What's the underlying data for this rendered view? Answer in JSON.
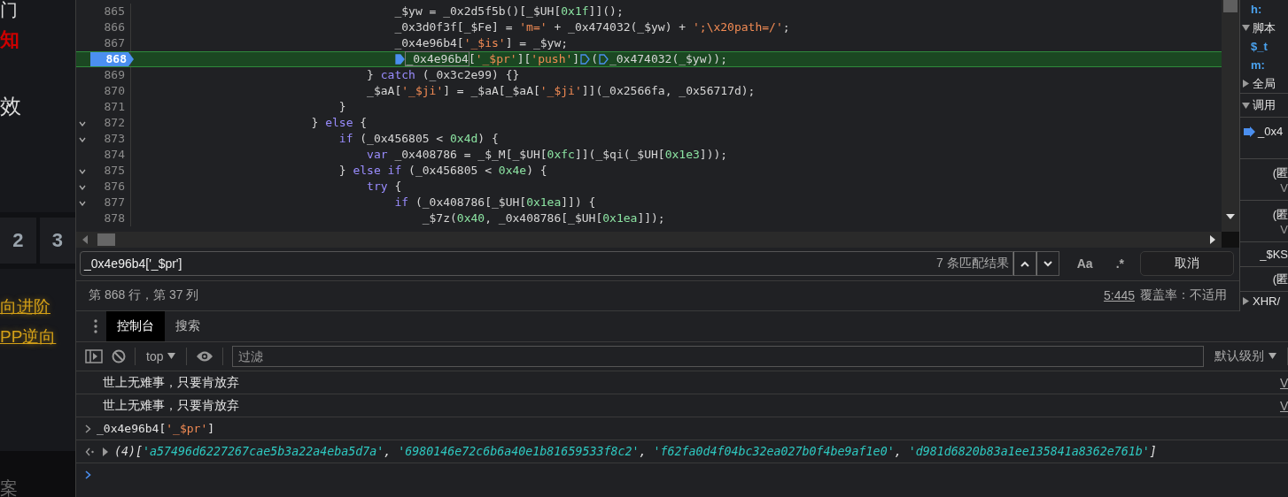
{
  "web_page": {
    "lines": [
      {
        "kind": "plain",
        "text": "门"
      },
      {
        "kind": "alert",
        "text": "知"
      },
      {
        "kind": "large",
        "text": "效"
      }
    ],
    "pager": [
      {
        "label": "2"
      },
      {
        "label": "3"
      }
    ],
    "links": [
      "向进阶",
      "PP逆向"
    ],
    "footer": "案"
  },
  "editor": {
    "lines": [
      {
        "number": "865",
        "fold": false,
        "current": false,
        "tokens": [
          {
            "kind": "plain",
            "text": "                                      _$yw = _0x2d5f5b()[_$UH["
          },
          {
            "kind": "number",
            "text": "0x1f"
          },
          {
            "kind": "plain",
            "text": "]]();"
          }
        ]
      },
      {
        "number": "866",
        "fold": false,
        "current": false,
        "tokens": [
          {
            "kind": "plain",
            "text": "                                      _0x3d0f3f[_$Fe] = "
          },
          {
            "kind": "string",
            "text": "'m='"
          },
          {
            "kind": "plain",
            "text": " + _0x474032(_$yw) + "
          },
          {
            "kind": "string",
            "text": "';\\x20path=/'"
          },
          {
            "kind": "plain",
            "text": ";"
          }
        ]
      },
      {
        "number": "867",
        "fold": false,
        "current": false,
        "tokens": [
          {
            "kind": "plain",
            "text": "                                      _0x4e96b4["
          },
          {
            "kind": "string",
            "text": "'_$is'"
          },
          {
            "kind": "plain",
            "text": "] = _$yw;"
          }
        ]
      },
      {
        "number": "868",
        "fold": false,
        "current": true,
        "tokens": [
          {
            "kind": "match",
            "marker_active": true,
            "text": "                                      _0x4e96b4"
          },
          {
            "kind": "plain",
            "text": "["
          },
          {
            "kind": "string",
            "text": "'_$pr'"
          },
          {
            "kind": "plain",
            "text": "]["
          },
          {
            "kind": "string",
            "text": "'push'"
          },
          {
            "kind": "plain",
            "text": "]"
          },
          {
            "kind": "marker",
            "active": false
          },
          {
            "kind": "plain",
            "text": "("
          },
          {
            "kind": "marker",
            "active": false
          },
          {
            "kind": "plain",
            "text": "_0x474032(_$yw));"
          }
        ]
      },
      {
        "number": "869",
        "fold": false,
        "current": false,
        "tokens": [
          {
            "kind": "plain",
            "text": "                                  } "
          },
          {
            "kind": "keyword",
            "text": "catch"
          },
          {
            "kind": "plain",
            "text": " (_0x3c2e99) {}"
          }
        ]
      },
      {
        "number": "870",
        "fold": false,
        "current": false,
        "tokens": [
          {
            "kind": "plain",
            "text": "                                  _$aA["
          },
          {
            "kind": "string",
            "text": "'_$ji'"
          },
          {
            "kind": "plain",
            "text": "] = _$aA[_$aA["
          },
          {
            "kind": "string",
            "text": "'_$ji'"
          },
          {
            "kind": "plain",
            "text": "]](_0x2566fa, _0x56717d);"
          }
        ]
      },
      {
        "number": "871",
        "fold": false,
        "current": false,
        "tokens": [
          {
            "kind": "plain",
            "text": "                              }"
          }
        ]
      },
      {
        "number": "872",
        "fold": true,
        "current": false,
        "tokens": [
          {
            "kind": "plain",
            "text": "                          } "
          },
          {
            "kind": "keyword",
            "text": "else"
          },
          {
            "kind": "plain",
            "text": " {"
          }
        ]
      },
      {
        "number": "873",
        "fold": true,
        "current": false,
        "tokens": [
          {
            "kind": "keyword",
            "text": "                              if"
          },
          {
            "kind": "plain",
            "text": " (_0x456805 < "
          },
          {
            "kind": "number",
            "text": "0x4d"
          },
          {
            "kind": "plain",
            "text": ") {"
          }
        ]
      },
      {
        "number": "874",
        "fold": false,
        "current": false,
        "tokens": [
          {
            "kind": "keyword",
            "text": "                                  var"
          },
          {
            "kind": "plain",
            "text": " _0x408786 = _$_M[_$UH["
          },
          {
            "kind": "number",
            "text": "0xfc"
          },
          {
            "kind": "plain",
            "text": "]](_$qi(_$UH["
          },
          {
            "kind": "number",
            "text": "0x1e3"
          },
          {
            "kind": "plain",
            "text": "]));"
          }
        ]
      },
      {
        "number": "875",
        "fold": true,
        "current": false,
        "tokens": [
          {
            "kind": "plain",
            "text": "                              } "
          },
          {
            "kind": "keyword",
            "text": "else if"
          },
          {
            "kind": "plain",
            "text": " (_0x456805 < "
          },
          {
            "kind": "number",
            "text": "0x4e"
          },
          {
            "kind": "plain",
            "text": ") {"
          }
        ]
      },
      {
        "number": "876",
        "fold": true,
        "current": false,
        "tokens": [
          {
            "kind": "keyword",
            "text": "                                  try"
          },
          {
            "kind": "plain",
            "text": " {"
          }
        ]
      },
      {
        "number": "877",
        "fold": true,
        "current": false,
        "tokens": [
          {
            "kind": "keyword",
            "text": "                                      if"
          },
          {
            "kind": "plain",
            "text": " (_0x408786[_$UH["
          },
          {
            "kind": "number",
            "text": "0x1ea"
          },
          {
            "kind": "plain",
            "text": "]]) {"
          }
        ]
      },
      {
        "number": "878",
        "fold": false,
        "current": false,
        "tokens": [
          {
            "kind": "plain",
            "text": "                                          _$7z("
          },
          {
            "kind": "number",
            "text": "0x40"
          },
          {
            "kind": "plain",
            "text": ", _0x408786[_$UH["
          },
          {
            "kind": "number",
            "text": "0x1ea"
          },
          {
            "kind": "plain",
            "text": "]]);"
          }
        ]
      }
    ]
  },
  "search": {
    "value": "_0x4e96b4['_$pr']",
    "matches": "7 条匹配结果",
    "case_button": "Aa",
    "regex_button": ".*",
    "cancel": "取消"
  },
  "status_bar": {
    "position": "第 868 行，第 37 列",
    "location": "5:445",
    "coverage": "覆盖率：不适用"
  },
  "sidebar": {
    "rows": [
      {
        "kind": "key",
        "text": "h:"
      },
      {
        "kind": "section",
        "text": "脚本",
        "expanded": true
      },
      {
        "kind": "key",
        "text": "$_t"
      },
      {
        "kind": "key",
        "text": "m:"
      },
      {
        "kind": "section",
        "text": "全局",
        "expanded": false
      },
      {
        "kind": "header",
        "text": "调用",
        "expanded": true
      },
      {
        "kind": "frame",
        "text": "_0x4",
        "current": true
      },
      {
        "kind": "frame",
        "text": "(匿",
        "sub": "V",
        "current": false
      },
      {
        "kind": "frame",
        "text": "(匿",
        "sub": "V",
        "current": false
      },
      {
        "kind": "frame",
        "text": "_$KS",
        "current": false
      },
      {
        "kind": "frame",
        "text": "(匿",
        "current": false
      },
      {
        "kind": "section",
        "text": "XHR/",
        "expanded": false
      }
    ]
  },
  "console": {
    "tabs": [
      {
        "label": "控制台",
        "selected": true
      },
      {
        "label": "搜索",
        "selected": false
      }
    ],
    "context": "top",
    "filter": {
      "placeholder": "过滤"
    },
    "levels": "默认级别",
    "messages": [
      {
        "kind": "log",
        "text": "世上无难事，只要肯放弃",
        "source": "V"
      },
      {
        "kind": "log",
        "text": "世上无难事，只要肯放弃",
        "source": "V"
      },
      {
        "kind": "input",
        "tokens": [
          {
            "kind": "plain",
            "text": "_0x4e96b4["
          },
          {
            "kind": "string",
            "text": "'_$pr'"
          },
          {
            "kind": "plain",
            "text": "]"
          }
        ]
      },
      {
        "kind": "result",
        "count": "(4)",
        "tokens": [
          {
            "kind": "plain",
            "text": "["
          },
          {
            "kind": "value",
            "text": "'a57496d6227267cae5b3a22a4eba5d7a'"
          },
          {
            "kind": "plain",
            "text": ", "
          },
          {
            "kind": "value",
            "text": "'6980146e72c6b6a40e1b81659533f8c2'"
          },
          {
            "kind": "plain",
            "text": ", "
          },
          {
            "kind": "value",
            "text": "'f62fa0d4f04bc32ea027b0f4be9af1e0'"
          },
          {
            "kind": "plain",
            "text": ", "
          },
          {
            "kind": "value",
            "text": "'d981d6820b83a1ee135841a8362e761b'"
          },
          {
            "kind": "plain",
            "text": "]"
          }
        ]
      },
      {
        "kind": "prompt"
      }
    ]
  }
}
